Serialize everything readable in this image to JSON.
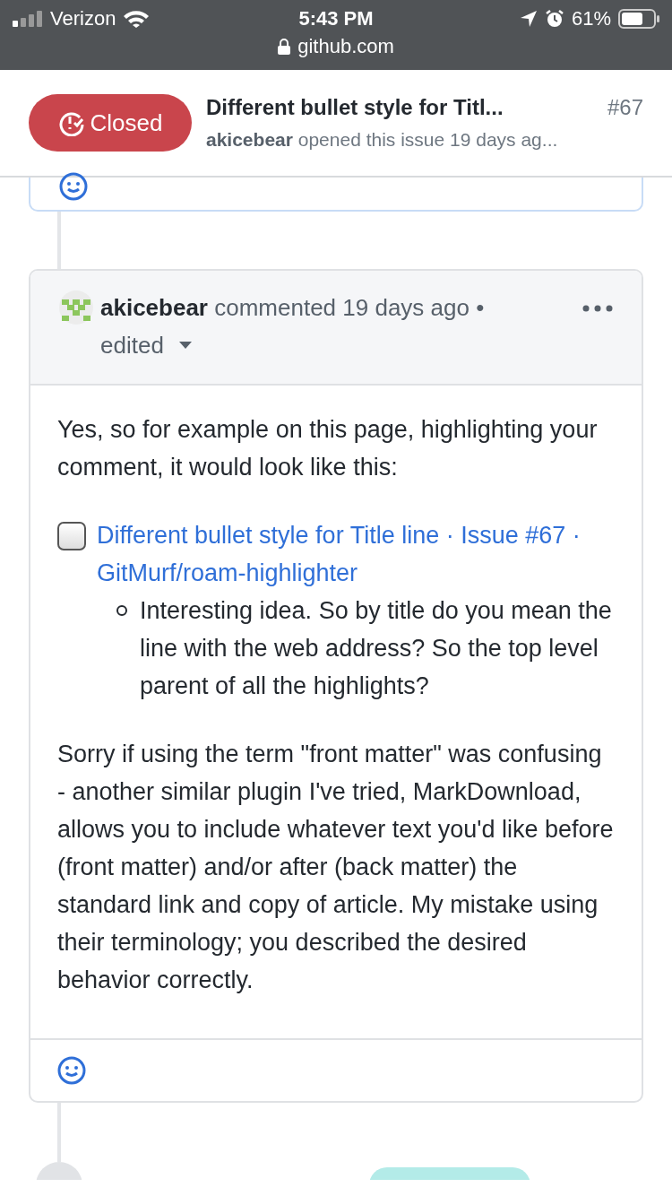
{
  "status_bar": {
    "carrier": "Verizon",
    "time": "5:43 PM",
    "battery": "61%",
    "url": "github.com"
  },
  "issue_header": {
    "state": "Closed",
    "title": "Different bullet style for Titl...",
    "number": "#67",
    "author": "akicebear",
    "meta": "opened this issue 19 days ag..."
  },
  "comment": {
    "author": "akicebear",
    "meta": "commented 19 days ago •",
    "edited": "edited",
    "intro": "Yes, so for example on this page, highlighting your comment, it would look like this:",
    "task": {
      "checked": false,
      "link": "Different bullet style for Title line · Issue #67 · GitMurf/roam-highlighter"
    },
    "bullets": [
      "Interesting idea. So by title do you mean the line with the web address? So the top level parent of all the highlights?"
    ],
    "body": "Sorry if using the term \"front matter\" was confusing - another similar plugin I've tried, MarkDownload, allows you to include whatever text you'd like before (front matter) and/or after (back matter) the standard link and copy of article. My mistake using their terminology; you described the desired behavior correctly."
  }
}
